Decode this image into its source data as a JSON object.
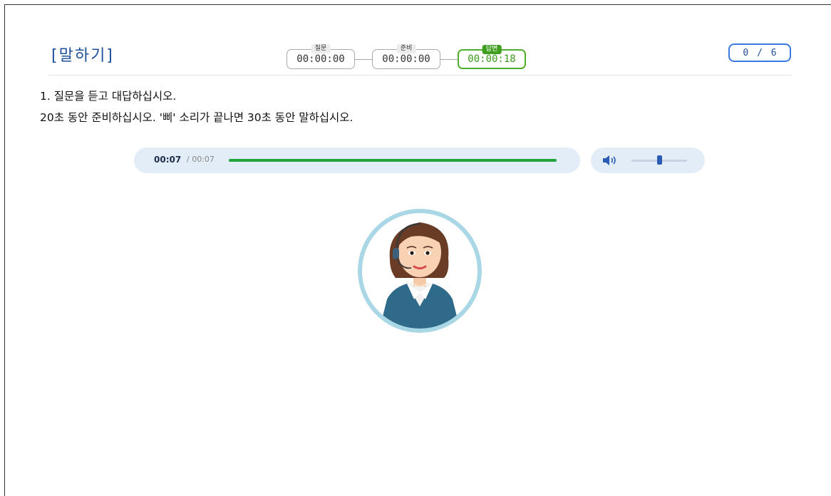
{
  "header": {
    "title": "[말하기]",
    "timers": [
      {
        "label": "질문",
        "value": "00:00:00",
        "active": false
      },
      {
        "label": "준비",
        "value": "00:00:00",
        "active": false
      },
      {
        "label": "답변",
        "value": "00:00:18",
        "active": true
      }
    ],
    "progress": {
      "text": "0 / 6",
      "current": 0,
      "total": 6
    }
  },
  "instructions": {
    "line1": "1. 질문을 듣고 대답하십시오.",
    "line2": "20초 동안 준비하십시오. '삐' 소리가 끝나면 30초 동안 말하십시오."
  },
  "player": {
    "current_time": "00:07",
    "total_time": "/ 00:07",
    "progress_fraction": 1.0,
    "progress_color": "#22a43a"
  },
  "volume": {
    "icon": "speaker-icon",
    "level_fraction": 0.5
  },
  "avatar": {
    "icon": "operator-avatar-icon",
    "ring_color": "#a9d7e6"
  },
  "colors": {
    "accent": "#1d4f9a",
    "active_timer": "#3f9d1f",
    "badge_border": "#3b7be0"
  }
}
